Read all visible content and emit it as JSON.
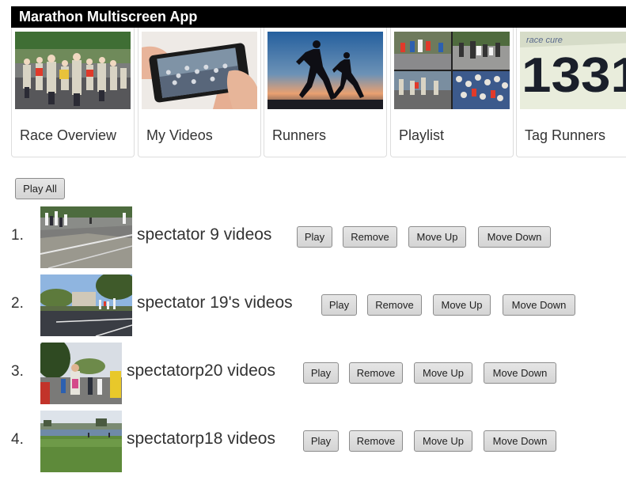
{
  "app": {
    "title": "Marathon Multiscreen App"
  },
  "tiles": [
    {
      "label": "Race Overview",
      "icon": "race-photo"
    },
    {
      "label": "My Videos",
      "icon": "phone-video-photo"
    },
    {
      "label": "Runners",
      "icon": "runners-silhouette-photo"
    },
    {
      "label": "Playlist",
      "icon": "playlist-collage-photo"
    },
    {
      "label": "Tag Runners",
      "icon": "race-bib-photo"
    }
  ],
  "controls": {
    "play_all": "Play All"
  },
  "playlist": [
    {
      "number": "1.",
      "title": "spectator 9 videos"
    },
    {
      "number": "2.",
      "title": "spectator 19's videos"
    },
    {
      "number": "3.",
      "title": "spectatorp20 videos"
    },
    {
      "number": "4.",
      "title": "spectatorp18 videos"
    }
  ],
  "row_actions": {
    "play": "Play",
    "remove": "Remove",
    "move_up": "Move Up",
    "move_down": "Move Down"
  },
  "bib": {
    "brand": "race cure",
    "number": "1331"
  }
}
